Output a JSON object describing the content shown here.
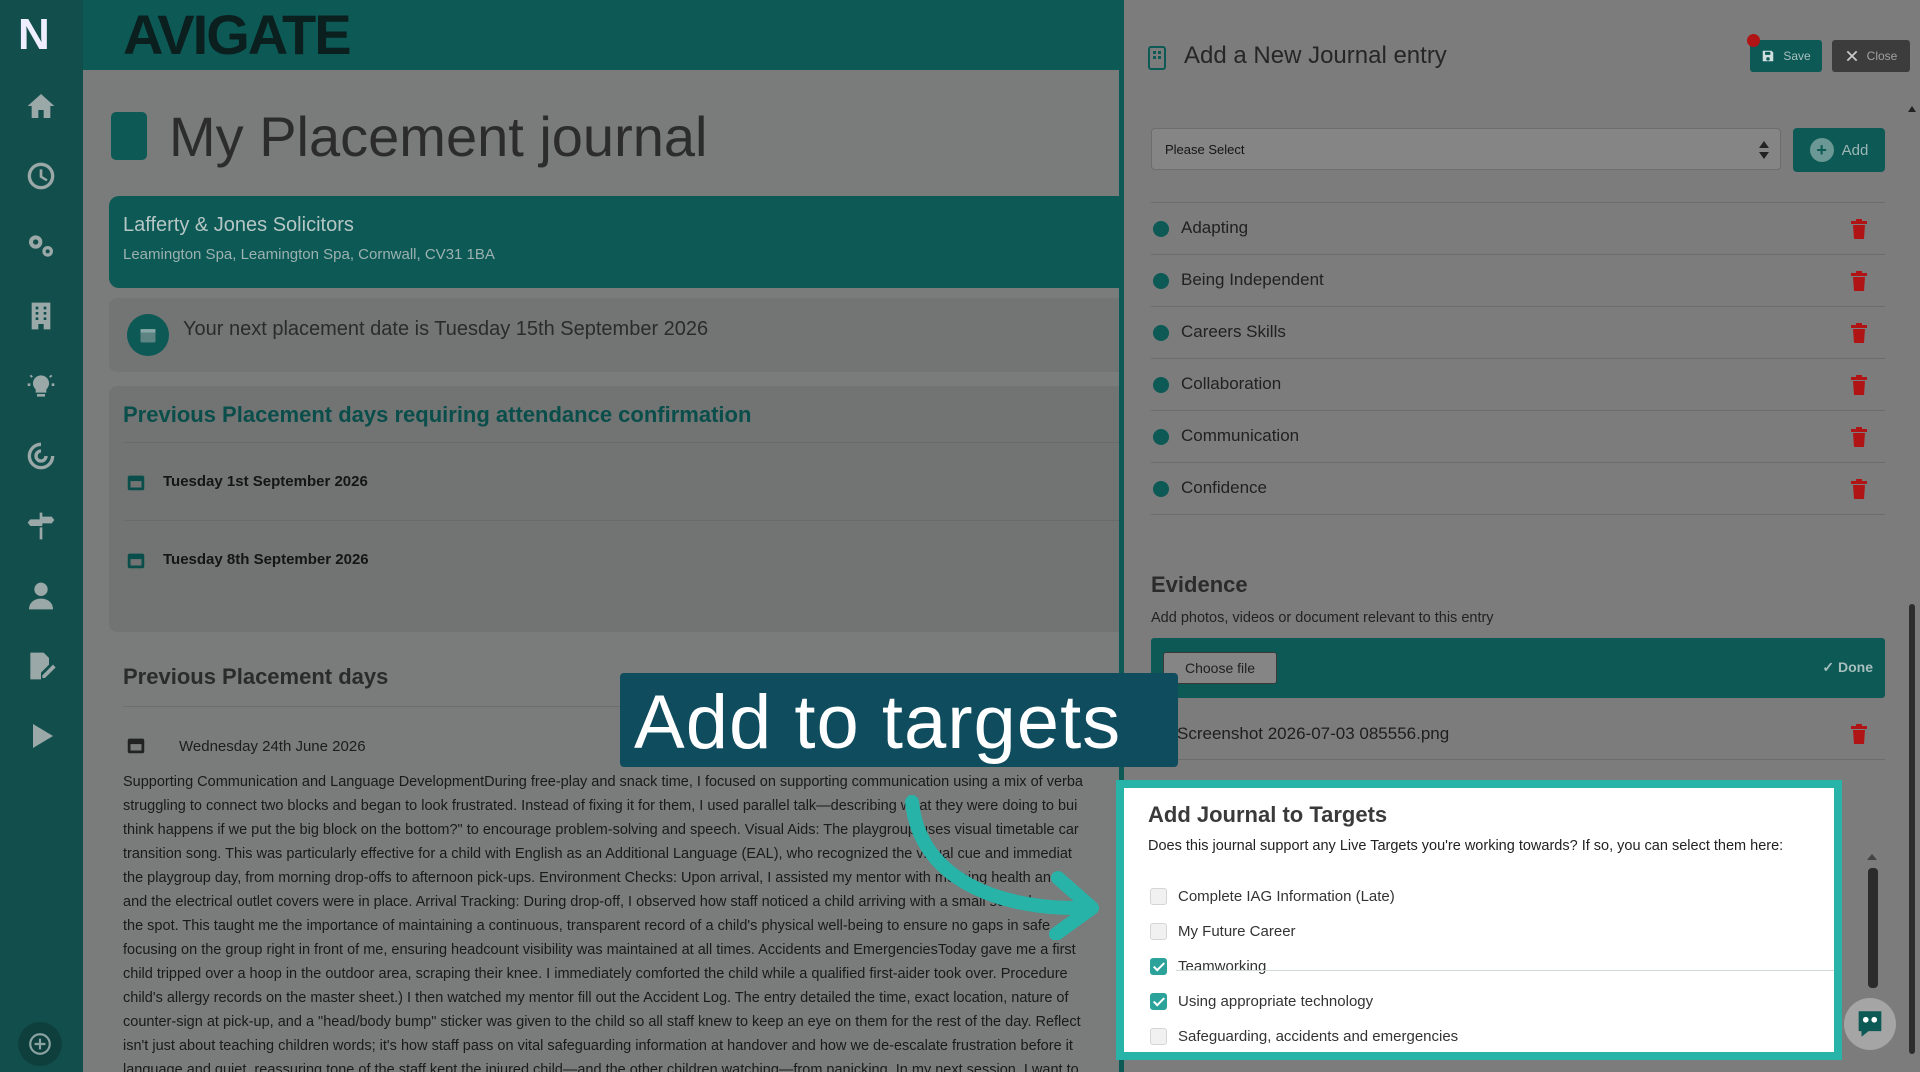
{
  "sidebar": {
    "logo": "N",
    "icons": [
      "home-icon",
      "clock-icon",
      "gears-icon",
      "building-icon",
      "lightbulb-icon",
      "target-icon",
      "signpost-icon",
      "user-icon",
      "edit-document-icon",
      "play-icon"
    ],
    "help_icon": "plus-circle-icon"
  },
  "header": {
    "brand": "AVIGATE"
  },
  "page": {
    "title": "My Placement journal",
    "employer": {
      "name": "Lafferty & Jones Solicitors",
      "address": "Leamington Spa, Leamington Spa, Cornwall, CV31 1BA"
    },
    "next_placement": "Your next placement date is Tuesday 15th September 2026",
    "confirm_section": {
      "heading": "Previous Placement days requiring attendance confirmation",
      "dates": [
        "Tuesday 1st September 2026",
        "Tuesday 8th September 2026"
      ]
    },
    "previous_days": {
      "heading": "Previous Placement days",
      "entry_date": "Wednesday 24th June 2026",
      "entry_lines": [
        "Supporting Communication and Language DevelopmentDuring free-play and snack time, I focused on supporting communication using a mix of verba",
        "struggling to connect two blocks and began to look frustrated. Instead of fixing it for them, I used parallel talk—describing what they were doing to bui",
        "think happens if we put the big block on the bottom?\" to encourage problem-solving and speech. Visual Aids: The playgroup uses visual timetable car",
        "transition song. This was particularly effective for a child with English as an Additional Language (EAL), who recognized the visual cue and immediat",
        "the playgroup day, from morning drop-offs to afternoon pick-ups. Environment Checks: Upon arrival, I assisted my mentor with morning health and",
        "and the electrical outlet covers were in place. Arrival Tracking: During drop-off, I observed how staff noticed a child arriving with a small scratch",
        "the spot. This taught me the importance of maintaining a continuous, transparent record of a child's physical well-being to ensure no gaps in safe",
        "focusing on the group right in front of me, ensuring headcount visibility was maintained at all times. Accidents and EmergenciesToday gave me a first",
        "child tripped over a hoop in the outdoor area, scraping their knee. I immediately comforted the child while a qualified first-aider took over. Procedure",
        "child's allergy records on the master sheet.) I then watched my mentor fill out the Accident Log. The entry detailed the time, exact location, nature of",
        "counter-sign at pick-up, and a \"head/body bump\" sticker was given to the child so all staff knew to keep an eye on them for the rest of the day. Reflect",
        "isn't just about teaching children words; it's how staff pass on vital safeguarding information at handover and how we de-escalate frustration before it",
        "language and quiet, reassuring tone of the staff kept the injured child—and the other children watching—from panicking. In my next session, I want to"
      ]
    }
  },
  "panel": {
    "title": "Add a New Journal entry",
    "save_label": "Save",
    "close_label": "Close",
    "select_value": "Please Select",
    "add_label": "Add",
    "skills": [
      "Adapting",
      "Being Independent",
      "Careers Skills",
      "Collaboration",
      "Communication",
      "Confidence"
    ],
    "evidence": {
      "heading": "Evidence",
      "subtitle": "Add photos, videos or document relevant to this entry",
      "choose_label": "Choose file",
      "done_label": "Done",
      "file_name": "Screenshot 2026-07-03 085556.png"
    },
    "targets": {
      "heading": "Add Journal to Targets",
      "subtitle": "Does this journal support any Live Targets you're working towards? If so, you can select them here:",
      "items": [
        {
          "label": "Complete IAG Information (Late)",
          "checked": false
        },
        {
          "label": "My Future Career",
          "checked": false
        },
        {
          "label": "Teamworking",
          "checked": true
        },
        {
          "label": "Using appropriate technology",
          "checked": true
        },
        {
          "label": "Safeguarding, accidents and emergencies",
          "checked": false
        }
      ]
    }
  },
  "callout": {
    "text": "Add to targets"
  },
  "colors": {
    "teal": "#0c5955",
    "highlight": "#27b3a8",
    "callout_bg": "#0e4c5e",
    "delete_red": "#b01414"
  }
}
